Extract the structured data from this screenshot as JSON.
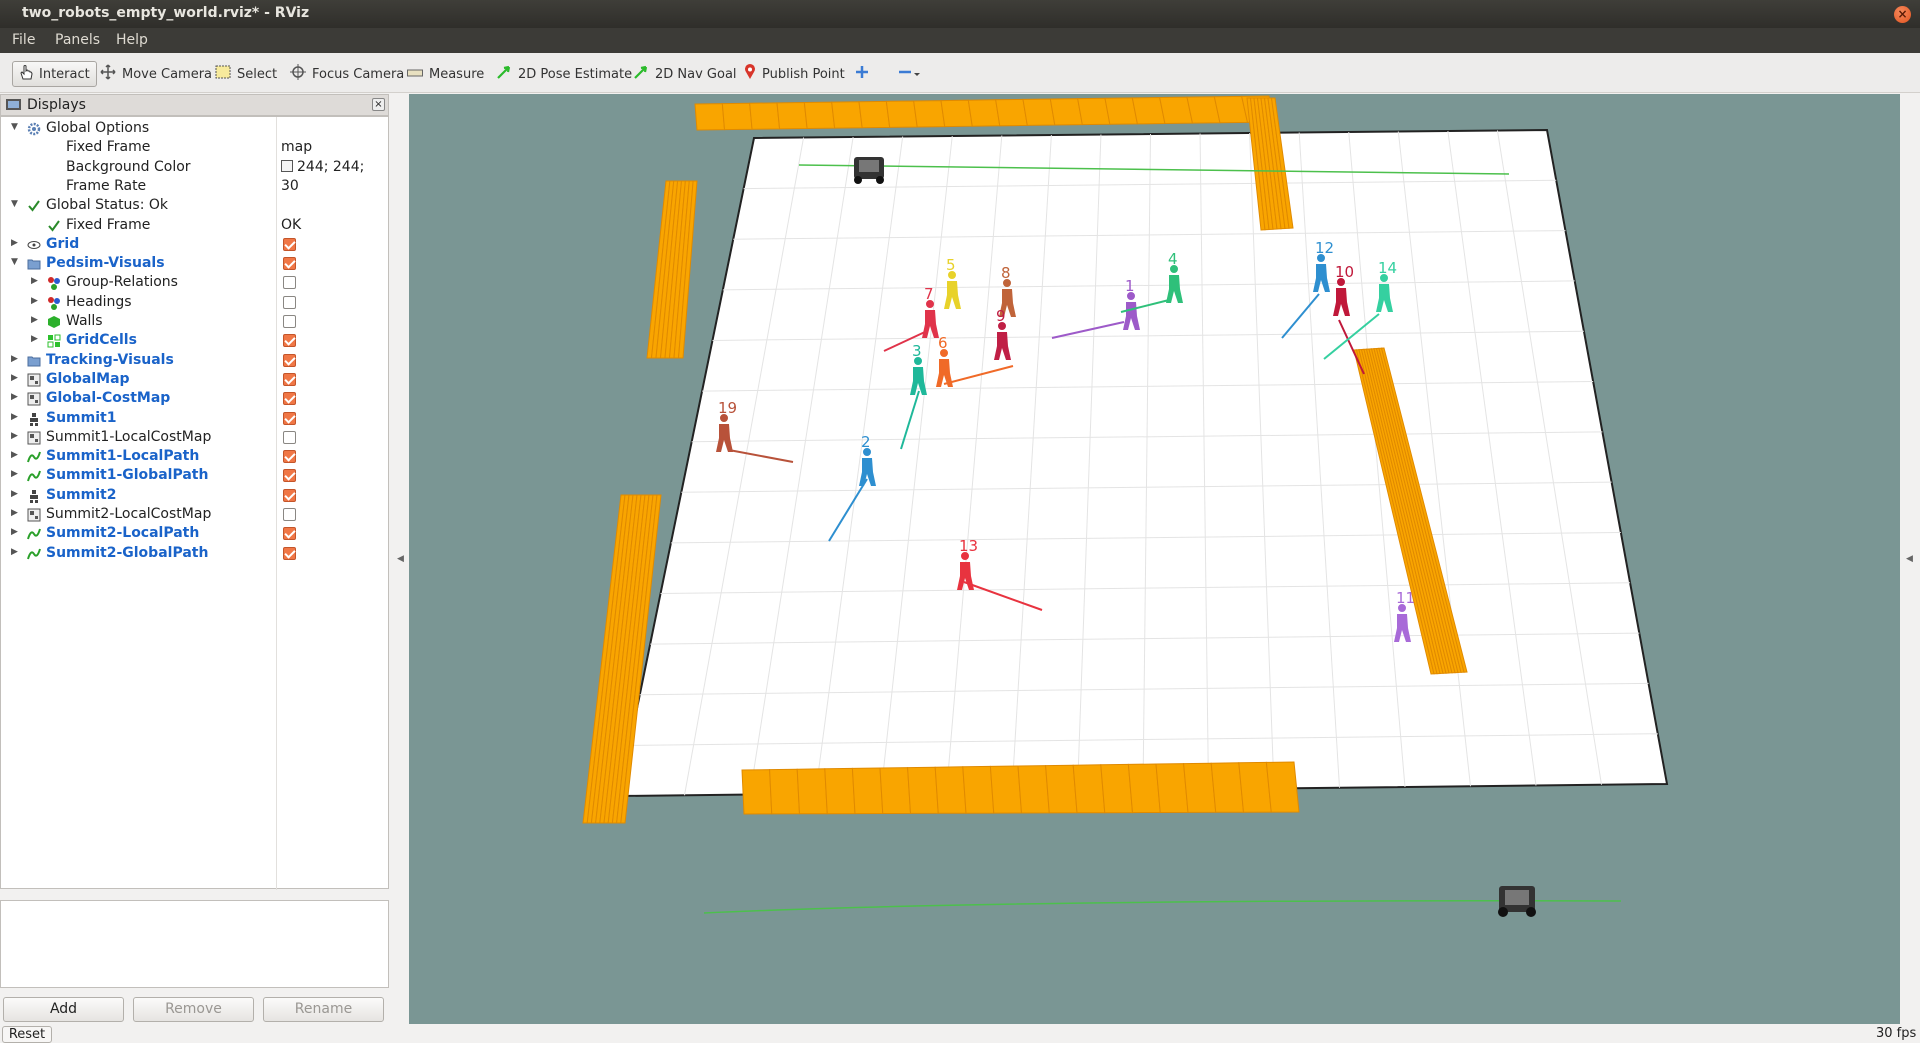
{
  "window": {
    "title": "two_robots_empty_world.rviz* - RViz"
  },
  "menu": [
    "File",
    "Panels",
    "Help"
  ],
  "toolbar": {
    "tools": [
      {
        "label": "Interact",
        "icon": "hand-icon",
        "active": true
      },
      {
        "label": "Move Camera",
        "icon": "move-camera-icon"
      },
      {
        "label": "Select",
        "icon": "select-icon"
      },
      {
        "label": "Focus Camera",
        "icon": "focus-camera-icon"
      },
      {
        "label": "Measure",
        "icon": "ruler-icon"
      },
      {
        "label": "2D Pose Estimate",
        "icon": "green-arrow-icon"
      },
      {
        "label": "2D Nav Goal",
        "icon": "green-arrow-icon"
      },
      {
        "label": "Publish Point",
        "icon": "map-pin-icon"
      }
    ]
  },
  "displays": {
    "title": "Displays",
    "rows": [
      {
        "name": "Global Options",
        "level": 0,
        "expand": "open",
        "icon": "gear-icon"
      },
      {
        "name": "Fixed Frame",
        "level": 1,
        "value": "map"
      },
      {
        "name": "Background Color",
        "level": 1,
        "value": "244; 244;",
        "swatch": true
      },
      {
        "name": "Frame Rate",
        "level": 1,
        "value": "30"
      },
      {
        "name": "Global Status: Ok",
        "level": 0,
        "expand": "open",
        "icon": "check-icon"
      },
      {
        "name": "Fixed Frame",
        "level": 1,
        "value": "OK",
        "icon": "check-icon"
      },
      {
        "name": "Grid",
        "level": 0,
        "expand": "closed",
        "icon": "grid-icon",
        "blue": true,
        "checked": true
      },
      {
        "name": "Pedsim-Visuals",
        "level": 0,
        "expand": "open",
        "icon": "folder-icon",
        "blue": true,
        "checked": true
      },
      {
        "name": "Group-Relations",
        "level": 1,
        "expand": "closed",
        "icon": "marker-array-icon",
        "checked": false
      },
      {
        "name": "Headings",
        "level": 1,
        "expand": "closed",
        "icon": "marker-array-icon",
        "checked": false
      },
      {
        "name": "Walls",
        "level": 1,
        "expand": "closed",
        "icon": "marker-icon",
        "checked": false
      },
      {
        "name": "GridCells",
        "level": 1,
        "expand": "closed",
        "icon": "gridcells-icon",
        "blue": true,
        "checked": true
      },
      {
        "name": "Tracking-Visuals",
        "level": 0,
        "expand": "closed",
        "icon": "folder-icon",
        "blue": true,
        "checked": true
      },
      {
        "name": "GlobalMap",
        "level": 0,
        "expand": "closed",
        "icon": "map-icon",
        "blue": true,
        "checked": true
      },
      {
        "name": "Global-CostMap",
        "level": 0,
        "expand": "closed",
        "icon": "map-icon",
        "blue": true,
        "checked": true
      },
      {
        "name": "Summit1",
        "level": 0,
        "expand": "closed",
        "icon": "robot-model-icon",
        "blue": true,
        "checked": true
      },
      {
        "name": "Summit1-LocalCostMap",
        "level": 0,
        "expand": "closed",
        "icon": "map-icon",
        "checked": false
      },
      {
        "name": "Summit1-LocalPath",
        "level": 0,
        "expand": "closed",
        "icon": "path-icon",
        "blue": true,
        "checked": true
      },
      {
        "name": "Summit1-GlobalPath",
        "level": 0,
        "expand": "closed",
        "icon": "path-icon",
        "blue": true,
        "checked": true
      },
      {
        "name": "Summit2",
        "level": 0,
        "expand": "closed",
        "icon": "robot-model-icon",
        "blue": true,
        "checked": true
      },
      {
        "name": "Summit2-LocalCostMap",
        "level": 0,
        "expand": "closed",
        "icon": "map-icon",
        "checked": false
      },
      {
        "name": "Summit2-LocalPath",
        "level": 0,
        "expand": "closed",
        "icon": "path-icon",
        "blue": true,
        "checked": true
      },
      {
        "name": "Summit2-GlobalPath",
        "level": 0,
        "expand": "closed",
        "icon": "path-icon",
        "blue": true,
        "checked": true
      }
    ],
    "buttons": {
      "add": "Add",
      "remove": "Remove",
      "rename": "Rename"
    }
  },
  "scene": {
    "wall_color": "#f9a500",
    "floor_color": "#ffffff",
    "background_color": "#7a9694",
    "agents": [
      {
        "id": "1",
        "color": "#9d5ac9"
      },
      {
        "id": "2",
        "color": "#2e8fd0"
      },
      {
        "id": "3",
        "color": "#1fb89a"
      },
      {
        "id": "4",
        "color": "#2fc07a"
      },
      {
        "id": "5",
        "color": "#e8d22a"
      },
      {
        "id": "6",
        "color": "#f06a28"
      },
      {
        "id": "7",
        "color": "#e0334a"
      },
      {
        "id": "8",
        "color": "#c0643a"
      },
      {
        "id": "9",
        "color": "#c01f45"
      },
      {
        "id": "10",
        "color": "#c0183a"
      },
      {
        "id": "11",
        "color": "#a86ad8"
      },
      {
        "id": "12",
        "color": "#2e8fd0"
      },
      {
        "id": "13",
        "color": "#e8333f"
      },
      {
        "id": "14",
        "color": "#35d0a0"
      },
      {
        "id": "19",
        "color": "#b8523a"
      }
    ]
  },
  "status": {
    "reset": "Reset",
    "fps": "30 fps"
  }
}
